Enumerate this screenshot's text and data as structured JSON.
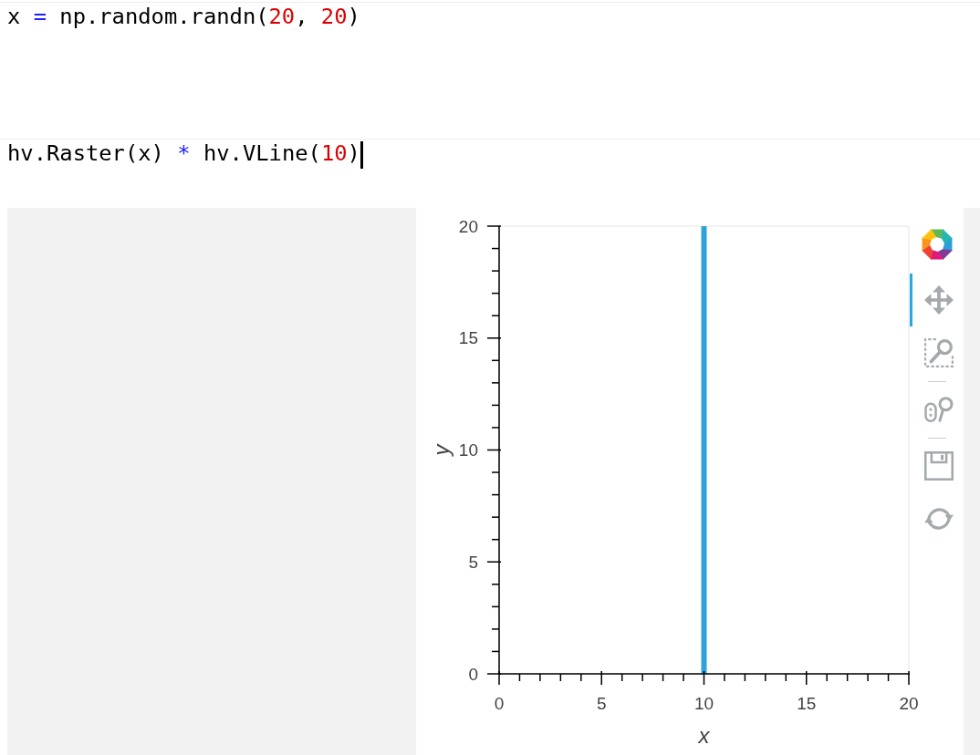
{
  "cells": [
    {
      "cursor": false,
      "code": [
        {
          "kind": "plain",
          "text": "x "
        },
        {
          "kind": "operator",
          "text": "="
        },
        {
          "kind": "plain",
          "text": " np.random.randn("
        },
        {
          "kind": "number",
          "text": "20"
        },
        {
          "kind": "plain",
          "text": ", "
        },
        {
          "kind": "number",
          "text": "20"
        },
        {
          "kind": "plain",
          "text": ")"
        }
      ]
    },
    {
      "cursor": true,
      "code": [
        {
          "kind": "plain",
          "text": "hv.Raster(x) "
        },
        {
          "kind": "operator",
          "text": "*"
        },
        {
          "kind": "plain",
          "text": " hv.VLine("
        },
        {
          "kind": "number",
          "text": "10"
        },
        {
          "kind": "plain",
          "text": ")"
        }
      ],
      "output": {
        "plot": {
          "chart_data": {
            "type": "line",
            "xlabel": "x",
            "ylabel": "y",
            "x": [
              10,
              10
            ],
            "series": [
              {
                "color": "#30a2da",
                "values": [
                  0,
                  20
                ]
              }
            ],
            "xlim": [
              0,
              20
            ],
            "ylim": [
              0,
              20
            ],
            "xticks": [
              0,
              5,
              10,
              15,
              20
            ],
            "yticks": [
              0,
              5,
              10,
              15,
              20
            ]
          },
          "toolbar": {
            "groups": [
              {
                "tools": [
                  {
                    "kind": "pan",
                    "selected": true
                  },
                  {
                    "kind": "box_zoom",
                    "selected": false
                  }
                ]
              },
              {
                "tools": [
                  {
                    "kind": "wheel_zoom",
                    "selected": false
                  }
                ]
              },
              {
                "tools": [
                  {
                    "kind": "save",
                    "selected": false
                  },
                  {
                    "kind": "reset",
                    "selected": false
                  }
                ]
              }
            ]
          }
        }
      }
    }
  ]
}
